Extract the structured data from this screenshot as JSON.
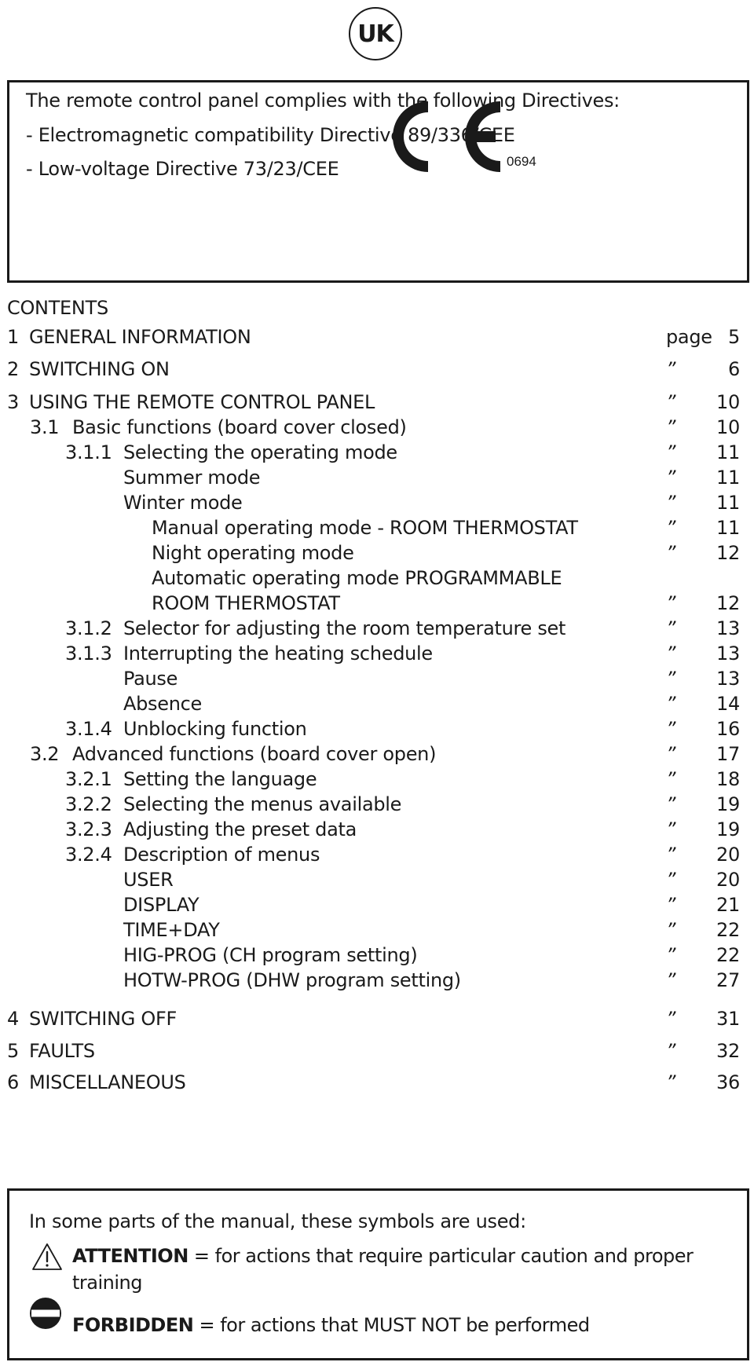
{
  "header": {
    "language_badge": "UK"
  },
  "directives": {
    "intro": "The remote control panel complies with the following Directives:",
    "items": [
      "- Electromagnetic compatibility Directive 89/336/CEE",
      "- Low-voltage Directive 73/23/CEE"
    ],
    "ce_mark_icon": "ce-mark-icon",
    "ce_code": "0694"
  },
  "contents": {
    "title": "CONTENTS",
    "page_word": "page",
    "ditto": "”",
    "entries": [
      {
        "num": "1",
        "label": "GENERAL INFORMATION",
        "page": "5",
        "level": 0
      },
      {
        "num": "2",
        "label": "SWITCHING ON",
        "page": "6",
        "level": 0
      },
      {
        "num": "3",
        "label": "USING THE REMOTE CONTROL PANEL",
        "page": "10",
        "level": 0
      },
      {
        "num": "3.1",
        "label": "Basic functions (board cover closed)",
        "page": "10",
        "level": 1
      },
      {
        "num": "3.1.1",
        "label": "Selecting the operating mode",
        "page": "11",
        "level": 2
      },
      {
        "num": "",
        "label": "Summer mode",
        "page": "11",
        "level": 3
      },
      {
        "num": "",
        "label": "Winter mode",
        "page": "11",
        "level": 3
      },
      {
        "num": "",
        "label": "Manual operating mode - ROOM THERMOSTAT",
        "page": "11",
        "level": 4
      },
      {
        "num": "",
        "label": "Night operating mode",
        "page": "12",
        "level": 4
      },
      {
        "num": "",
        "label": "Automatic operating mode PROGRAMMABLE",
        "page": "",
        "level": 4
      },
      {
        "num": "",
        "label": "ROOM THERMOSTAT",
        "page": "12",
        "level": 4
      },
      {
        "num": "3.1.2",
        "label": "Selector for adjusting the room temperature set",
        "page": "13",
        "level": 2
      },
      {
        "num": "3.1.3",
        "label": "Interrupting the heating schedule",
        "page": "13",
        "level": 2
      },
      {
        "num": "",
        "label": "Pause",
        "page": "13",
        "level": 3
      },
      {
        "num": "",
        "label": "Absence",
        "page": "14",
        "level": 3
      },
      {
        "num": "3.1.4",
        "label": "Unblocking function",
        "page": "16",
        "level": 2
      },
      {
        "num": "3.2",
        "label": "Advanced functions (board cover open)",
        "page": "17",
        "level": 1
      },
      {
        "num": "3.2.1",
        "label": "Setting the language",
        "page": "18",
        "level": 2
      },
      {
        "num": "3.2.2",
        "label": "Selecting the menus available",
        "page": "19",
        "level": 2
      },
      {
        "num": "3.2.3",
        "label": "Adjusting the preset data",
        "page": "19",
        "level": 2
      },
      {
        "num": "3.2.4",
        "label": "Description of menus",
        "page": "20",
        "level": 2
      },
      {
        "num": "",
        "label": "USER",
        "page": "20",
        "level": 3
      },
      {
        "num": "",
        "label": "DISPLAY",
        "page": "21",
        "level": 3
      },
      {
        "num": "",
        "label": "TIME+DAY",
        "page": "22",
        "level": 3
      },
      {
        "num": "",
        "label": "HIG-PROG (CH program setting)",
        "page": "22",
        "level": 3
      },
      {
        "num": "",
        "label": "HOTW-PROG (DHW program setting)",
        "page": "27",
        "level": 3
      },
      {
        "num": "4",
        "label": "SWITCHING OFF",
        "page": "31",
        "level": 0
      },
      {
        "num": "5",
        "label": "FAULTS",
        "page": "32",
        "level": 0
      },
      {
        "num": "6",
        "label": "MISCELLANEOUS",
        "page": "36",
        "level": 0
      }
    ]
  },
  "symbols": {
    "intro": "In some parts of the manual, these symbols are used:",
    "attention": {
      "icon": "warning-triangle-icon",
      "term": "ATTENTION",
      "definition_line1": " = for actions that require particular caution and proper",
      "definition_line2": "training"
    },
    "forbidden": {
      "icon": "no-entry-icon",
      "term": "FORBIDDEN",
      "definition": " = for actions that MUST NOT be performed"
    }
  }
}
